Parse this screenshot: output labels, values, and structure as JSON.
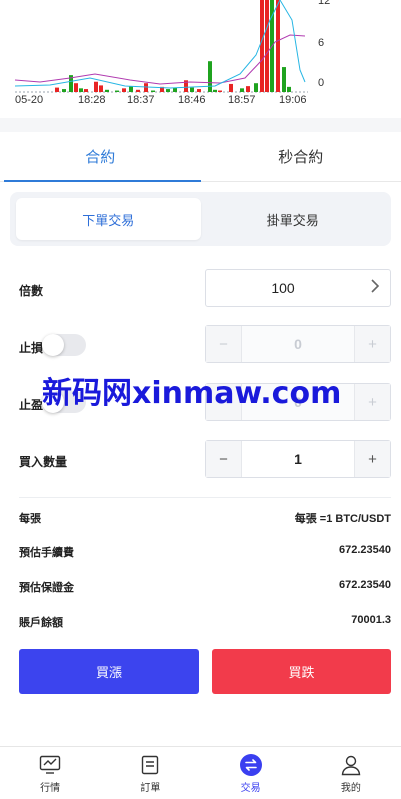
{
  "chart_data": {
    "type": "bar",
    "categories": [
      "05-20",
      "18:28",
      "18:37",
      "18:46",
      "18:57",
      "19:06"
    ],
    "yticks": [
      "12",
      "6",
      "0"
    ],
    "ylim": [
      0,
      12
    ],
    "xlabel": "",
    "ylabel": "",
    "title": "",
    "colors": {
      "up": "#1fa31f",
      "down": "#e82424",
      "ma1": "#b03ab0",
      "ma2": "#27b6e4"
    }
  },
  "tabs": [
    {
      "label": "合約",
      "active": true
    },
    {
      "label": "秒合約",
      "active": false
    }
  ],
  "segment": [
    {
      "label": "下單交易",
      "active": true
    },
    {
      "label": "掛單交易",
      "active": false
    }
  ],
  "form": {
    "multiplier_label": "倍數",
    "multiplier_value": "100",
    "stop_loss_label": "止損",
    "stop_loss_value": "0",
    "take_profit_label": "止盈",
    "take_profit_value": "0",
    "quantity_label": "買入數量",
    "quantity_value": "1",
    "minus": "−",
    "plus": "+",
    "chevron": "›"
  },
  "watermark": "新码网xinmaw.com",
  "info": [
    {
      "label": "每張",
      "value": "每張 =1 BTC/USDT"
    },
    {
      "label": "預估手續費",
      "value": "672.23540"
    },
    {
      "label": "預估保證金",
      "value": "672.23540"
    },
    {
      "label": "賬戶餘額",
      "value": "70001.3"
    }
  ],
  "actions": {
    "buy": "買漲",
    "sell": "買跌"
  },
  "nav": [
    {
      "label": "行情",
      "icon": "market-chart-icon",
      "active": false
    },
    {
      "label": "訂單",
      "icon": "orders-document-icon",
      "active": false
    },
    {
      "label": "交易",
      "icon": "exchange-arrows-icon",
      "active": true
    },
    {
      "label": "我的",
      "icon": "user-profile-icon",
      "active": false
    }
  ]
}
